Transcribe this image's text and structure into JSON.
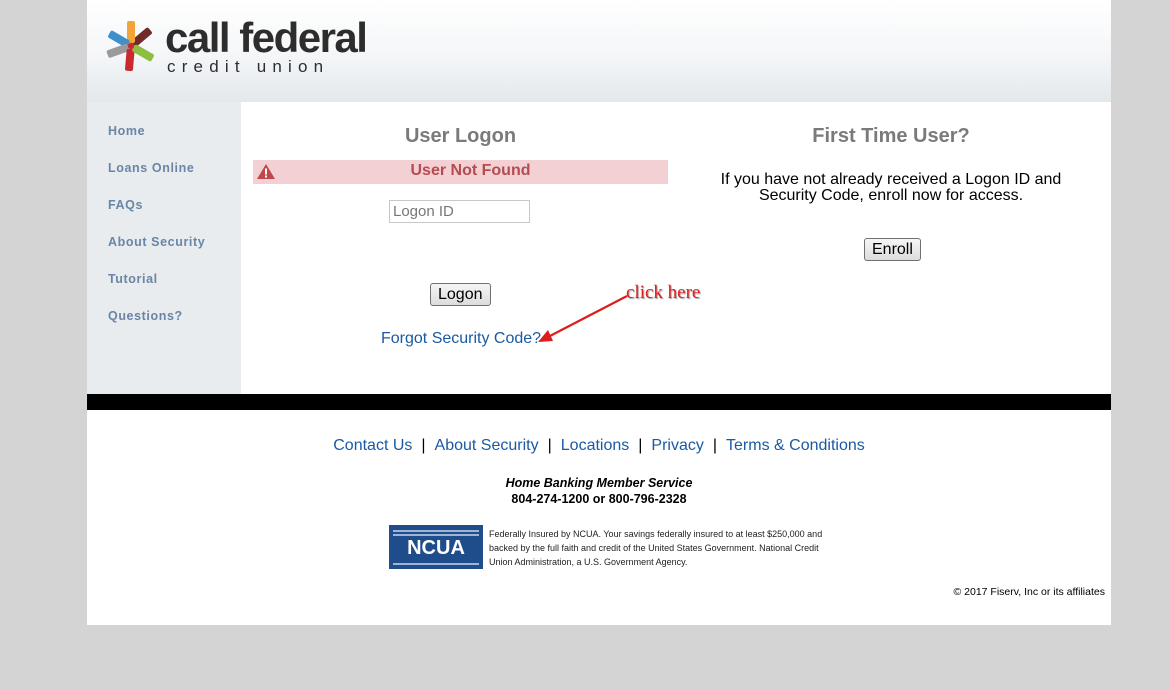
{
  "logo": {
    "wordmark": "call federal",
    "subline": "credit union"
  },
  "sidebar": {
    "items": [
      {
        "label": "Home"
      },
      {
        "label": "Loans Online"
      },
      {
        "label": "FAQs"
      },
      {
        "label": "About Security"
      },
      {
        "label": "Tutorial"
      },
      {
        "label": "Questions?"
      }
    ]
  },
  "logon": {
    "title": "User Logon",
    "error": "User Not Found",
    "input_placeholder": "Logon ID",
    "input_value": "",
    "button": "Logon",
    "forgot_link": "Forgot Security Code?"
  },
  "first_time": {
    "title": "First Time User?",
    "text": "If you have not already received a Logon ID and Security Code, enroll now for access.",
    "button": "Enroll"
  },
  "annotation": {
    "text": "click here",
    "color": "#e02020"
  },
  "footer": {
    "links": [
      "Contact Us",
      "About Security",
      "Locations",
      "Privacy",
      "Terms & Conditions"
    ],
    "separator": "|",
    "service_title": "Home Banking Member Service",
    "service_phones": "804-274-1200 or 800-796-2328",
    "ncua_logo_text": "NCUA",
    "ncua_text": "Federally Insured by NCUA. Your savings federally insured to at least $250,000 and backed by the full faith and credit of the United States Government. National Credit Union Administration, a U.S. Government Agency.",
    "copyright": "© 2017 Fiserv, Inc or its affiliates"
  },
  "colors": {
    "page_bg": "#d4d4d4",
    "nav_text": "#6a85a6",
    "link": "#1a5aa3",
    "error_bg": "#f2d0d4",
    "error_text": "#b54c4f",
    "ncua_blue": "#1f4d8c"
  }
}
